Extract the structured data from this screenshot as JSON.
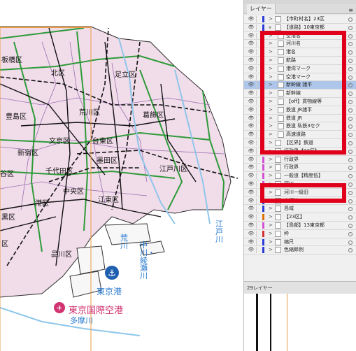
{
  "panel": {
    "tab": "レイヤー",
    "menu": "≡",
    "footer": "29レイヤー"
  },
  "map": {
    "wards": [
      "板橋区",
      "北区",
      "足立区",
      "荒川区",
      "豊島区",
      "葛飾区",
      "文京区",
      "台東区",
      "新宿区",
      "墨田区",
      "千代田区",
      "谷区",
      "江戸川区",
      "中央区",
      "江東区",
      "港区",
      "黒区",
      "品川区",
      "区"
    ],
    "rivers": [
      "荒川",
      "中川・綾瀬川",
      "江戸川",
      "多摩川"
    ],
    "port": "東京港",
    "airport": "東京国際空港"
  },
  "layers": [
    {
      "name": "【市町村名】23区",
      "color": "#2b3bd6",
      "child": false,
      "arrow": ">"
    },
    {
      "name": "【道路】10東京都",
      "color": "#2b3bd6",
      "child": false,
      "arrow": "v"
    },
    {
      "name": "空港名",
      "color": "#e0b400",
      "child": true,
      "arrow": ">"
    },
    {
      "name": "河川名",
      "color": "#e0b400",
      "child": true,
      "arrow": ">"
    },
    {
      "name": "港名",
      "color": "#e0b400",
      "child": true,
      "arrow": ">"
    },
    {
      "name": "航路",
      "color": "#e0b400",
      "child": true,
      "arrow": ">"
    },
    {
      "name": "港湾マーク",
      "color": "#e0b400",
      "child": true,
      "arrow": ">"
    },
    {
      "name": "空港マーク",
      "color": "#e0b400",
      "child": true,
      "arrow": ">"
    },
    {
      "name": "新幹線 諸平",
      "color": "#e0b400",
      "child": true,
      "arrow": ">",
      "selected": true
    },
    {
      "name": "新幹線",
      "color": "#e0b400",
      "child": true,
      "arrow": ">"
    },
    {
      "name": "【off】貨物線等",
      "color": "#e0b400",
      "child": true,
      "arrow": ">"
    },
    {
      "name": "鉄道 JR諸平",
      "color": "#e0b400",
      "child": true,
      "arrow": ">"
    },
    {
      "name": "鉄道 JR",
      "color": "#e0b400",
      "child": true,
      "arrow": ">"
    },
    {
      "name": "鉄道 私鉄3セク",
      "color": "#e0b400",
      "child": true,
      "arrow": ">"
    },
    {
      "name": "高速道路",
      "color": "#e0b400",
      "child": true,
      "arrow": ">"
    },
    {
      "name": "【区界】鉄道",
      "color": "#d44fd4",
      "child": false,
      "arrow": ">"
    },
    {
      "name": "行政界【23区】",
      "color": "#d44fd4",
      "child": false,
      "arrow": ">"
    },
    {
      "name": "行政界",
      "color": "#d44fd4",
      "child": false,
      "arrow": ">"
    },
    {
      "name": "行政界",
      "color": "#d44fd4",
      "child": false,
      "arrow": ">"
    },
    {
      "name": "一般道【精度低】",
      "color": "#d44fd4",
      "child": false,
      "arrow": ">"
    },
    {
      "name": "河川",
      "color": "#d44fd4",
      "child": false,
      "arrow": ">"
    },
    {
      "name": "河川一級旧",
      "color": "#2b3bd6",
      "child": false,
      "arrow": ">"
    },
    {
      "name": "水涯線",
      "color": "#2b3bd6",
      "child": false,
      "arrow": ">"
    },
    {
      "name": "島域",
      "color": "#2b3bd6",
      "child": false,
      "arrow": ">"
    },
    {
      "name": "【23区】",
      "color": "#e07000",
      "child": false,
      "arrow": ">"
    },
    {
      "name": "【島部】13東京都",
      "color": "#d44fd4",
      "child": false,
      "arrow": ">"
    },
    {
      "name": "枠",
      "color": "#d43030",
      "child": false,
      "arrow": ">"
    },
    {
      "name": "縮尺",
      "color": "#2b3bd6",
      "child": false,
      "arrow": ">"
    },
    {
      "name": "色縮郎例",
      "color": "#2b3bd6",
      "child": false,
      "arrow": ">"
    }
  ]
}
